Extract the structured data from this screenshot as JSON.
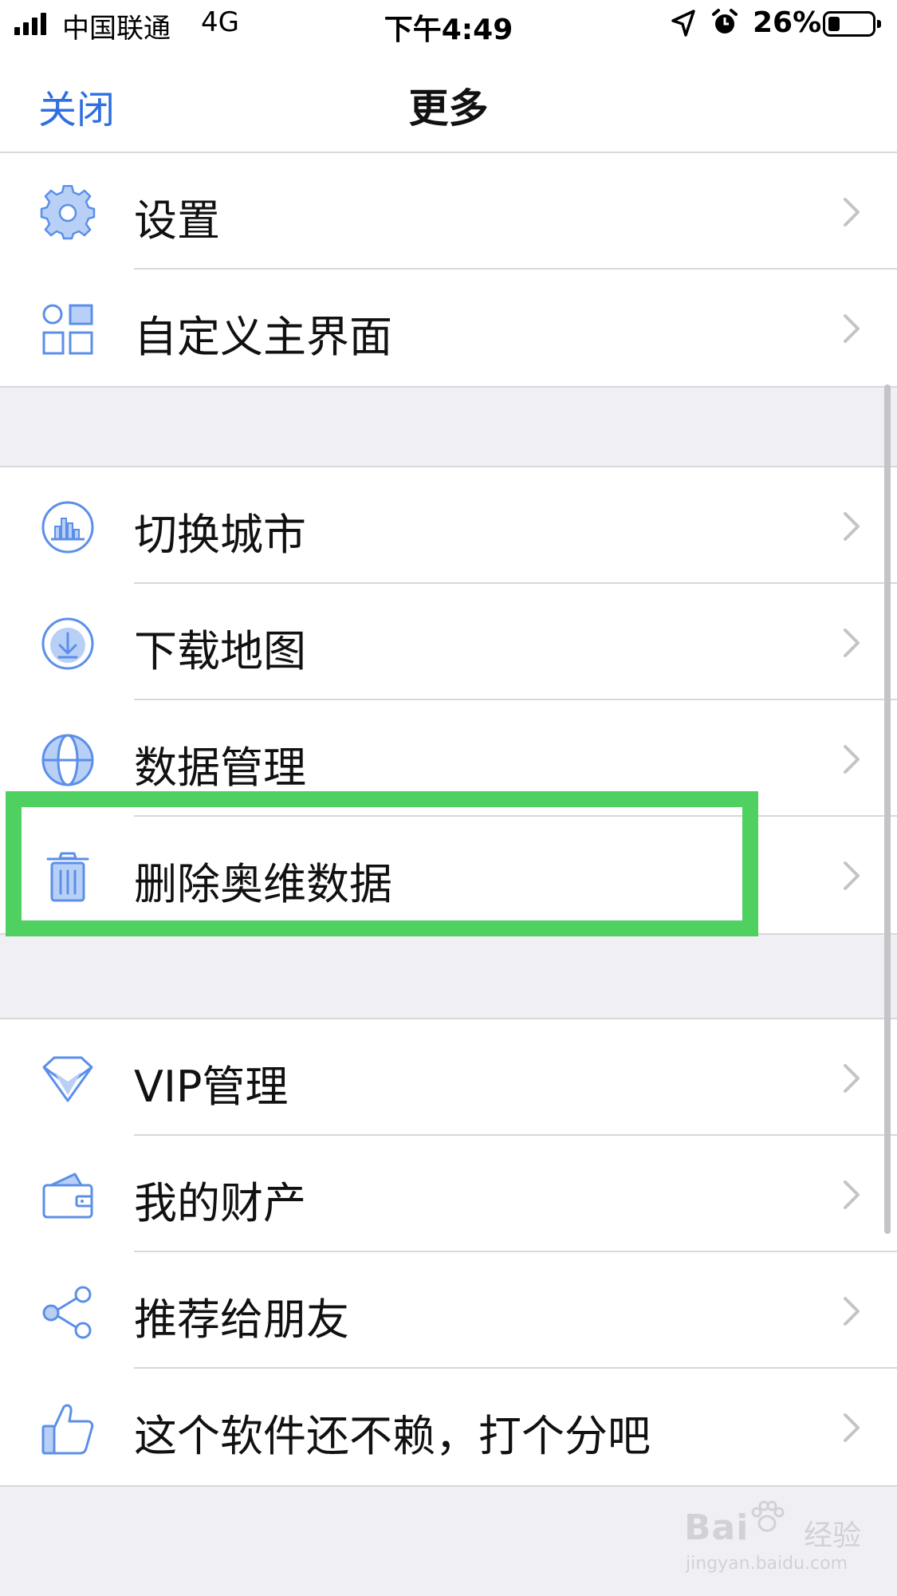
{
  "status_bar": {
    "carrier": "中国联通",
    "network": "4G",
    "time": "下午4:49",
    "battery_percent": "26%",
    "battery_level": 0.26
  },
  "nav": {
    "close_label": "关闭",
    "title": "更多"
  },
  "groups": [
    {
      "items": [
        {
          "label": "设置",
          "icon": "gear-icon"
        },
        {
          "label": "自定义主界面",
          "icon": "grid-icon"
        }
      ]
    },
    {
      "items": [
        {
          "label": "切换城市",
          "icon": "city-icon"
        },
        {
          "label": "下载地图",
          "icon": "download-icon"
        },
        {
          "label": "数据管理",
          "icon": "globe-icon"
        },
        {
          "label": "删除奥维数据",
          "icon": "trash-icon"
        }
      ]
    },
    {
      "items": [
        {
          "label": "VIP管理",
          "icon": "diamond-icon"
        },
        {
          "label": "我的财产",
          "icon": "wallet-icon"
        },
        {
          "label": "推荐给朋友",
          "icon": "share-icon"
        },
        {
          "label": "这个软件还不赖，打个分吧",
          "icon": "thumbs-up-icon"
        }
      ]
    }
  ],
  "colors": {
    "accent": "#2f6fe0",
    "icon": "#5b8fe8",
    "icon_fill": "#b9d0f6",
    "highlight": "#4fd162",
    "background": "#efeff4"
  },
  "watermark": {
    "brand": "Bai",
    "brand_suffix": "经验",
    "url": "jingyan.baidu.com"
  }
}
